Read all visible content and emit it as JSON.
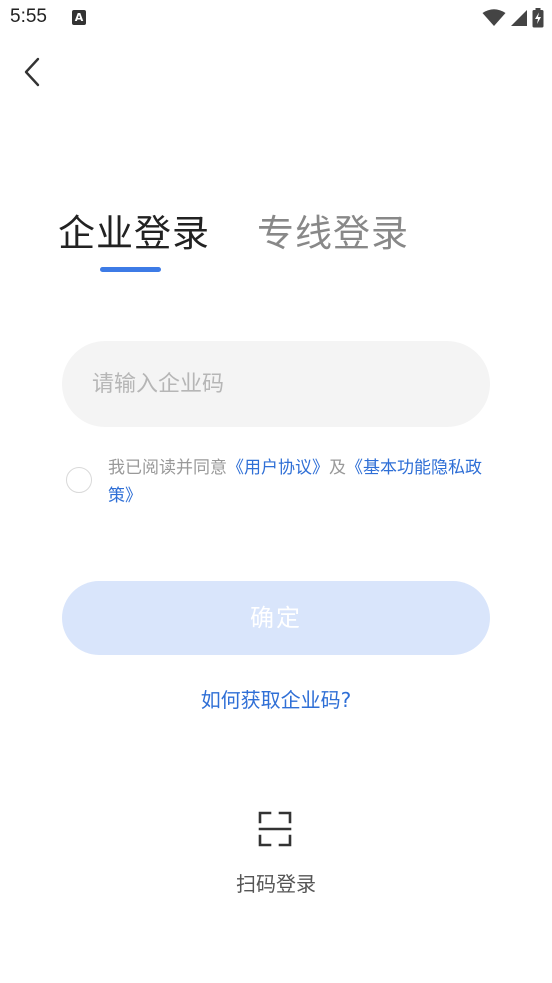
{
  "status_bar": {
    "time": "5:55",
    "notification_icon_letter": "A",
    "icons": [
      "wifi-icon",
      "signal-icon",
      "battery-charging-icon"
    ]
  },
  "nav": {
    "back_icon": "chevron-left-icon"
  },
  "tabs": [
    {
      "label": "企业登录",
      "active": true
    },
    {
      "label": "专线登录",
      "active": false
    }
  ],
  "form": {
    "enterprise_code_placeholder": "请输入企业码",
    "enterprise_code_value": ""
  },
  "agreement": {
    "checked": false,
    "prefix": "我已阅读并同意",
    "user_agreement": "《用户协议》",
    "conjunction": "及",
    "privacy_policy": "《基本功能隐私政策》"
  },
  "confirm_label": "确定",
  "help_link": "如何获取企业码?",
  "scan": {
    "icon": "scan-icon",
    "label": "扫码登录"
  },
  "colors": {
    "accent": "#3d7be6",
    "link": "#2f6fd6",
    "button_disabled_bg": "#d9e5fb",
    "input_bg": "#f4f4f4"
  }
}
